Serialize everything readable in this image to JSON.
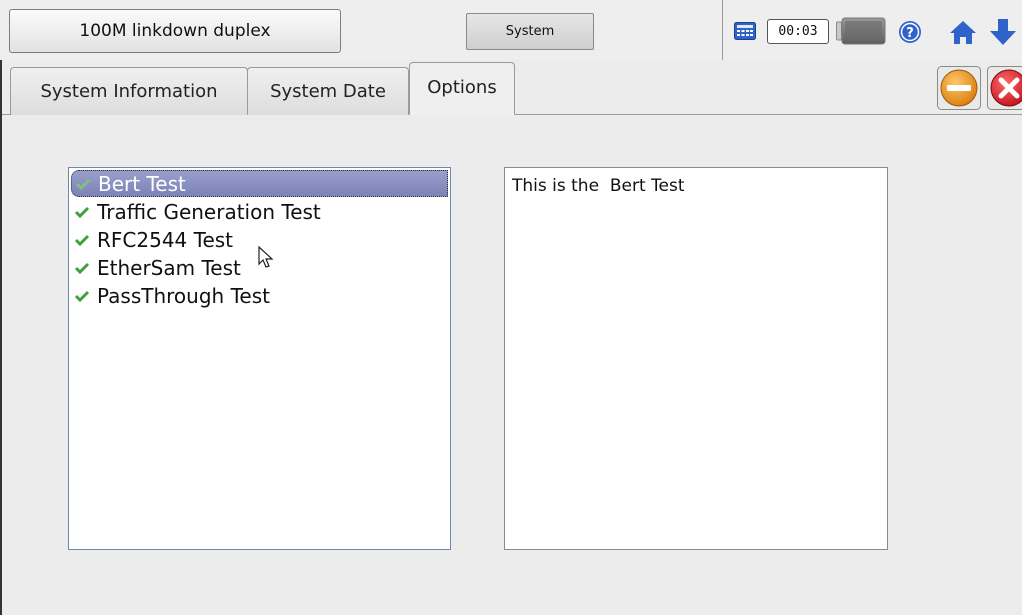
{
  "topbar": {
    "status_text": "100M linkdown duplex",
    "system_label": "System",
    "time": "00:03",
    "icons": [
      "calculator-icon",
      "battery-icon",
      "help-icon",
      "home-icon",
      "down-arrow-icon"
    ]
  },
  "tabs": [
    {
      "label": "System Information",
      "active": false
    },
    {
      "label": "System Date",
      "active": false
    },
    {
      "label": "Options",
      "active": true
    }
  ],
  "options": {
    "items": [
      {
        "label": "Bert Test",
        "selected": true
      },
      {
        "label": "Traffic Generation Test",
        "selected": false
      },
      {
        "label": "RFC2544 Test",
        "selected": false
      },
      {
        "label": "EtherSam Test",
        "selected": false
      },
      {
        "label": "PassThrough Test",
        "selected": false
      }
    ],
    "description": "This is the  Bert Test"
  },
  "colors": {
    "accent_blue": "#2f63c9",
    "selection": "#8a90c2",
    "check_green": "#3fa23f",
    "minimize_orange": "#e8901a",
    "close_red": "#d6202a"
  }
}
